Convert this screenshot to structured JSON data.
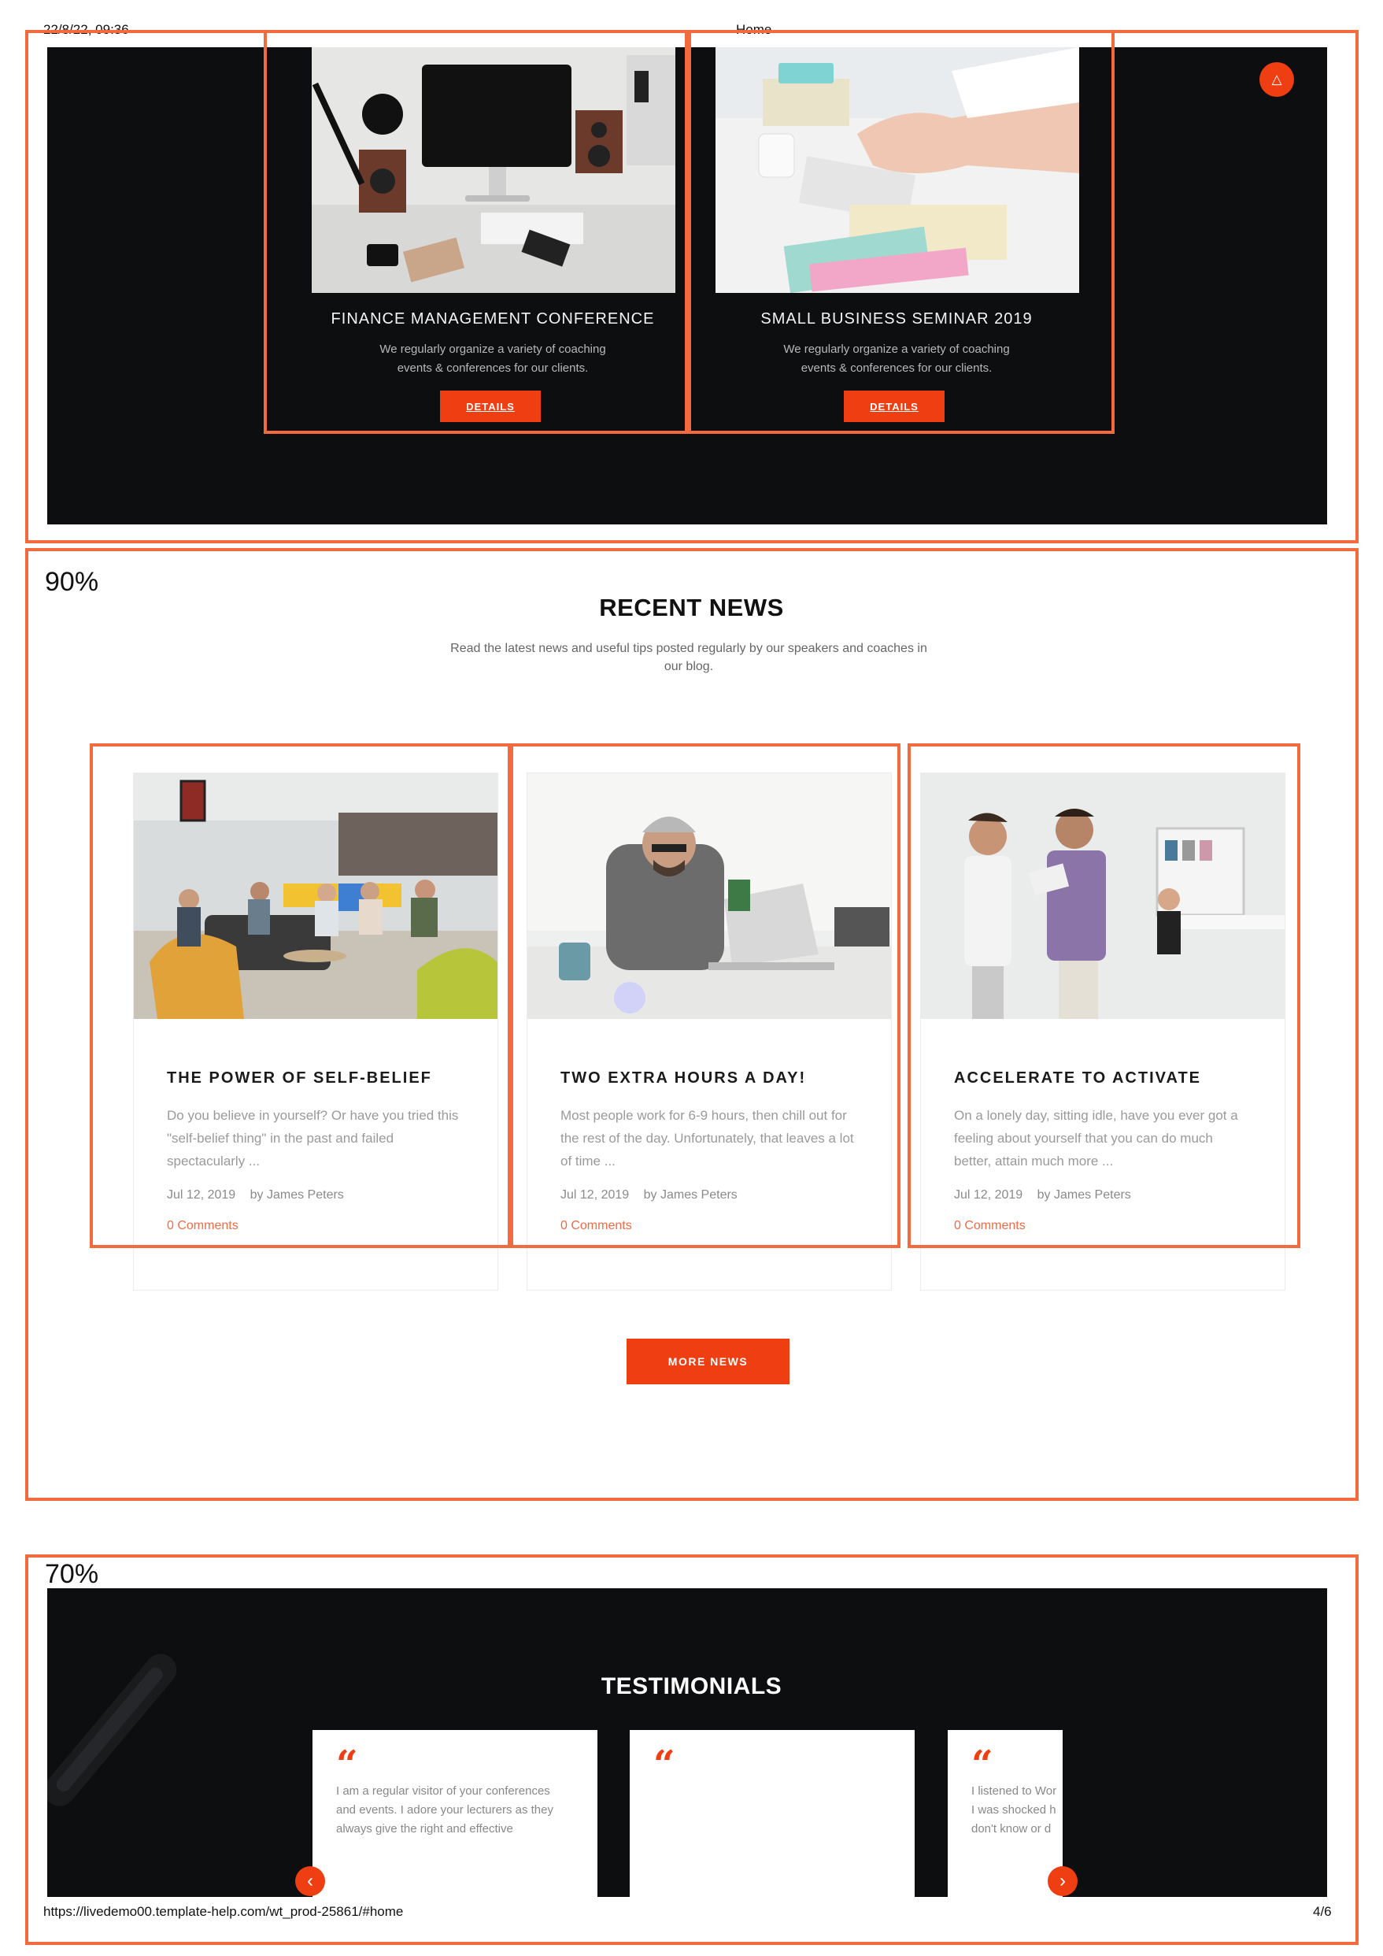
{
  "print": {
    "date": "22/8/22, 09:36",
    "page_title": "Home",
    "url": "https://livedemo00.template-help.com/wt_prod-25861/#home",
    "page_number": "4/6"
  },
  "zoom_labels": {
    "news": "90%",
    "testimonials": "70%"
  },
  "events": [
    {
      "title": "FINANCE MANAGEMENT CONFERENCE",
      "text": "We regularly organize a variety of coaching events & conferences for our clients.",
      "button": "DETAILS",
      "photo": "desk-computer-photo"
    },
    {
      "title": "SMALL BUSINESS SEMINAR 2019",
      "text": "We regularly organize a variety of coaching events & conferences for our clients.",
      "button": "DETAILS",
      "photo": "typing-hands-photo"
    }
  ],
  "scroll_top_icon": "scroll-top-icon",
  "news": {
    "heading": "RECENT NEWS",
    "subtitle": "Read the latest news and useful tips posted regularly by our speakers and coaches in our blog.",
    "more_button": "MORE NEWS",
    "posts": [
      {
        "title": "THE POWER OF SELF-BELIEF",
        "excerpt": "Do you believe in yourself? Or have you tried this \"self-belief thing\" in the past and failed spectacularly ...",
        "date": "Jul 12, 2019",
        "author": "by James Peters",
        "comments": "0 Comments"
      },
      {
        "title": "TWO EXTRA HOURS A DAY!",
        "excerpt": "Most people work for 6-9 hours, then chill out for the rest of the day. Unfortunately, that leaves a lot of time ...",
        "date": "Jul 12, 2019",
        "author": "by James Peters",
        "comments": "0 Comments"
      },
      {
        "title": "ACCELERATE TO ACTIVATE",
        "excerpt": "On a lonely day, sitting idle, have you ever got a feeling about yourself that you can do much better, attain much more ...",
        "date": "Jul 12, 2019",
        "author": "by James Peters",
        "comments": "0 Comments"
      }
    ]
  },
  "testimonials": {
    "heading": "TESTIMONIALS",
    "quote_glyph": "“",
    "cards": [
      {
        "text": "I am a regular visitor of your conferences\nand events. I adore your lecturers as they\nalways give the right and effective"
      },
      {
        "text": ""
      },
      {
        "text": "I listened to Wor\nI was shocked h\ndon't know or d"
      }
    ],
    "prev_arrow": "‹",
    "next_arrow": "›"
  },
  "colors": {
    "accent": "#ef3e12",
    "frame": "#f26a3d",
    "dark_bg": "#0d0e10"
  }
}
